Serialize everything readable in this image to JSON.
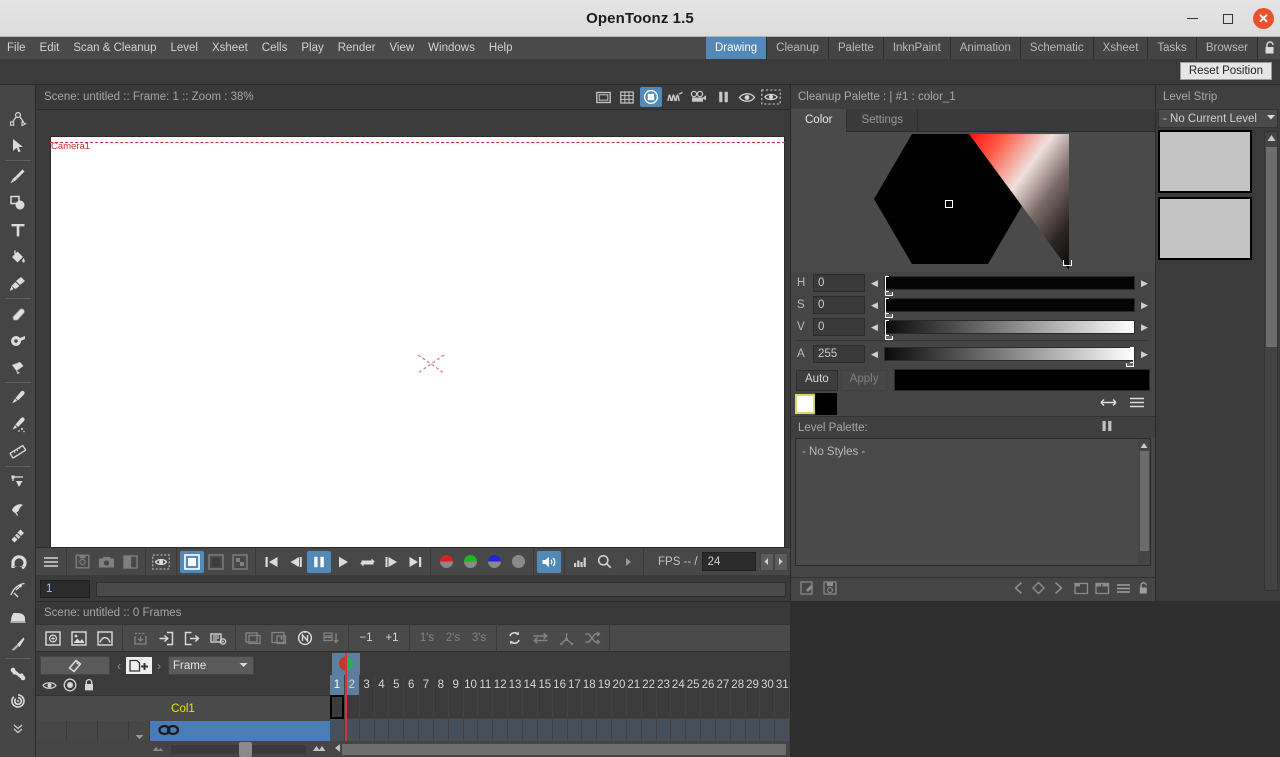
{
  "window": {
    "title": "OpenToonz 1.5",
    "minimize_icon": "minimize-icon",
    "maximize_icon": "maximize-icon",
    "close_icon": "close-icon"
  },
  "menubar": {
    "items": [
      {
        "label": "File"
      },
      {
        "label": "Edit"
      },
      {
        "label": "Scan & Cleanup"
      },
      {
        "label": "Level"
      },
      {
        "label": "Xsheet"
      },
      {
        "label": "Cells"
      },
      {
        "label": "Play"
      },
      {
        "label": "Render"
      },
      {
        "label": "View"
      },
      {
        "label": "Windows"
      },
      {
        "label": "Help"
      }
    ]
  },
  "rooms": {
    "tabs": [
      {
        "label": "Drawing",
        "active": true
      },
      {
        "label": "Cleanup",
        "active": false
      },
      {
        "label": "Palette",
        "active": false
      },
      {
        "label": "InknPaint",
        "active": false
      },
      {
        "label": "Animation",
        "active": false
      },
      {
        "label": "Schematic",
        "active": false
      },
      {
        "label": "Xsheet",
        "active": false
      },
      {
        "label": "Tasks",
        "active": false
      },
      {
        "label": "Browser",
        "active": false
      }
    ],
    "lock_icon": "unlocked-padlock-icon"
  },
  "toolbar_top": {
    "reset_position_label": "Reset Position"
  },
  "left_toolbar": {
    "tools": [
      {
        "name": "animate-tool",
        "icon": "animate-icon"
      },
      {
        "name": "selection-tool",
        "icon": "arrow-cursor-icon"
      },
      {
        "name": "brush-tool",
        "icon": "brush-icon"
      },
      {
        "name": "geometric-tool",
        "icon": "geometric-shapes-icon"
      },
      {
        "name": "type-tool",
        "icon": "text-t-icon"
      },
      {
        "name": "fill-tool",
        "icon": "paint-bucket-icon"
      },
      {
        "name": "smart-raster-brush-tool",
        "icon": "paint-brush-wide-icon"
      },
      {
        "name": "eraser-tool",
        "icon": "eraser-icon"
      },
      {
        "name": "tape-tool",
        "icon": "tape-icon"
      },
      {
        "name": "finger-tool",
        "icon": "finger-icon"
      },
      {
        "name": "style-picker-tool",
        "icon": "eyedropper-icon"
      },
      {
        "name": "rgb-picker-tool",
        "icon": "rgb-picker-icon"
      },
      {
        "name": "ruler-tool",
        "icon": "ruler-icon"
      },
      {
        "name": "control-point-editor-tool",
        "icon": "control-point-icon"
      },
      {
        "name": "pinch-tool",
        "icon": "pinch-icon"
      },
      {
        "name": "pump-tool",
        "icon": "pump-icon"
      },
      {
        "name": "magnet-tool",
        "icon": "magnet-icon"
      },
      {
        "name": "bender-tool",
        "icon": "bender-icon"
      },
      {
        "name": "iron-tool",
        "icon": "iron-icon"
      },
      {
        "name": "cutter-tool",
        "icon": "cutter-knife-icon"
      },
      {
        "name": "skeleton-tool",
        "icon": "bone-icon"
      },
      {
        "name": "tracker-tool",
        "icon": "spiral-tracker-icon"
      },
      {
        "name": "more-tools",
        "icon": "double-chevron-down-icon"
      }
    ]
  },
  "viewer": {
    "title": "Scene: untitled  ::  Frame: 1  ::  Zoom : 38%",
    "camera_label": "Camera1",
    "title_icons": [
      {
        "name": "safe-area-icon",
        "active": false
      },
      {
        "name": "field-guide-icon",
        "active": false
      },
      {
        "name": "camera-view-icon",
        "active": true
      },
      {
        "name": "3d-view-icon",
        "active": false
      },
      {
        "name": "camera-stand-view-icon",
        "active": false
      },
      {
        "name": "freeze-icon",
        "active": false
      },
      {
        "name": "preview-icon",
        "active": false
      },
      {
        "name": "subcamera-preview-icon",
        "active": false
      }
    ]
  },
  "playback": {
    "groups": [
      {
        "buttons": [
          {
            "name": "flipbook-menu",
            "icon": "hamburger-icon",
            "dim": false
          }
        ]
      },
      {
        "buttons": [
          {
            "name": "save-images-button",
            "icon": "save-image-icon",
            "dim": true
          },
          {
            "name": "snapshot-button",
            "icon": "camera-icon",
            "dim": true
          },
          {
            "name": "compare-button",
            "icon": "compare-icon",
            "dim": true
          }
        ]
      },
      {
        "buttons": [
          {
            "name": "histogram-toggle",
            "icon": "dotted-eye-icon",
            "dim": false
          }
        ]
      },
      {
        "buttons": [
          {
            "name": "white-bg-button",
            "icon": "white-bg-icon",
            "active": true
          },
          {
            "name": "black-bg-button",
            "icon": "black-bg-icon",
            "active": false
          },
          {
            "name": "checkered-bg-button",
            "icon": "checkered-bg-icon",
            "active": false
          }
        ]
      },
      {
        "buttons": [
          {
            "name": "first-frame-button",
            "icon": "skip-start-icon"
          },
          {
            "name": "previous-frame-button",
            "icon": "step-back-icon"
          },
          {
            "name": "pause-button",
            "icon": "pause-icon",
            "active": true
          },
          {
            "name": "play-button",
            "icon": "play-icon"
          },
          {
            "name": "loop-button",
            "icon": "loop-icon"
          },
          {
            "name": "next-frame-button",
            "icon": "step-forward-icon"
          },
          {
            "name": "last-frame-button",
            "icon": "skip-end-icon"
          }
        ]
      },
      {
        "buttons": [
          {
            "name": "red-channel-button",
            "icon": "red-channel-icon",
            "color": "#e02020"
          },
          {
            "name": "green-channel-button",
            "icon": "green-channel-icon",
            "color": "#21b521"
          },
          {
            "name": "blue-channel-button",
            "icon": "blue-channel-icon",
            "color": "#2323d8"
          },
          {
            "name": "matte-channel-button",
            "icon": "matte-channel-icon",
            "color": "#8a8a8a"
          }
        ]
      },
      {
        "buttons": [
          {
            "name": "sound-button",
            "icon": "speaker-icon",
            "active": true
          }
        ]
      },
      {
        "buttons": [
          {
            "name": "histogram-button",
            "icon": "bar-histogram-icon"
          },
          {
            "name": "zoom-button",
            "icon": "magnifier-icon"
          },
          {
            "name": "more-button",
            "icon": "triangle-right-icon"
          }
        ]
      }
    ],
    "fps_label": "FPS -- /",
    "fps_value": "24",
    "spin_left": "◀",
    "spin_right": "▶"
  },
  "frame_bar": {
    "current_frame": "1"
  },
  "cleanup_palette": {
    "title": "Cleanup Palette :  | #1 : color_1",
    "tabs": [
      {
        "label": "Color",
        "active": true
      },
      {
        "label": "Settings",
        "active": false
      }
    ],
    "sliders": [
      {
        "label": "H",
        "value": "0",
        "pos": 0,
        "type": "hue"
      },
      {
        "label": "S",
        "value": "0",
        "pos": 0,
        "type": "sat"
      },
      {
        "label": "V",
        "value": "0",
        "pos": 0,
        "type": "val"
      },
      {
        "label": "A",
        "value": "255",
        "pos": 100,
        "type": "alpha"
      }
    ],
    "auto_label": "Auto",
    "apply_label": "Apply",
    "preview_color": "#000000",
    "swatch_current": "#ffffff",
    "swatch_new": "#000000",
    "swatch_icons": [
      {
        "name": "swap-colors-icon"
      },
      {
        "name": "palette-options-menu-icon"
      }
    ],
    "bottom_icons": [
      {
        "name": "edit-palette-icon"
      },
      {
        "name": "save-palette-icon"
      },
      {
        "name": "previous-key-icon"
      },
      {
        "name": "set-key-icon"
      },
      {
        "name": "next-key-icon"
      },
      {
        "name": "new-style-page-icon"
      },
      {
        "name": "new-page-icon"
      },
      {
        "name": "options-menu-icon"
      },
      {
        "name": "lock-palette-icon"
      }
    ]
  },
  "level_palette": {
    "title": "Level Palette:",
    "freeze_icon": "pause-freeze-icon",
    "empty_text": "- No Styles -"
  },
  "level_strip": {
    "title": "Level Strip",
    "current_level": "- No Current Level",
    "dropdown_icon": "chevron-down-icon",
    "frames": [
      {
        "name": "level-strip-cell-1"
      },
      {
        "name": "level-strip-cell-2"
      }
    ]
  },
  "xsheet": {
    "title": "Scene: untitled  ::  0 Frames",
    "toolbar_groups": [
      {
        "buttons": [
          {
            "name": "new-vector-level-button",
            "icon": "new-vector-level-icon",
            "dim": false
          },
          {
            "name": "new-toonz-raster-level-button",
            "icon": "new-raster-level-icon",
            "dim": false
          },
          {
            "name": "new-raster-level-button",
            "icon": "new-raster-plain-icon",
            "dim": false
          }
        ]
      },
      {
        "buttons": [
          {
            "name": "save-all-levels-button",
            "icon": "save-all-icon",
            "dim": true
          },
          {
            "name": "load-level-button",
            "icon": "load-level-icon",
            "dim": false
          },
          {
            "name": "export-level-button",
            "icon": "export-level-icon",
            "dim": false
          },
          {
            "name": "scan-settings-button",
            "icon": "scan-settings-icon",
            "dim": false
          }
        ]
      },
      {
        "buttons": [
          {
            "name": "toggle-edit-in-place-button",
            "icon": "edit-in-place-icon",
            "dim": true
          },
          {
            "name": "sub-xsheet-button",
            "icon": "sub-xsheet-icon",
            "dim": true
          },
          {
            "name": "toggle-autorenumber-button",
            "icon": "circled-n-icon",
            "dim": false
          },
          {
            "name": "collapse-button",
            "icon": "collapse-rows-icon",
            "dim": true
          }
        ]
      },
      {
        "buttons": [
          {
            "name": "decrease-step-button",
            "label": "−1",
            "dim": false
          },
          {
            "name": "increase-step-button",
            "label": "+1",
            "dim": false
          }
        ]
      },
      {
        "buttons": [
          {
            "name": "step-1-button",
            "label": "1's",
            "dim": true
          },
          {
            "name": "step-2-button",
            "label": "2's",
            "dim": true
          },
          {
            "name": "step-3-button",
            "label": "3's",
            "dim": true
          }
        ]
      },
      {
        "buttons": [
          {
            "name": "repeat-button",
            "icon": "repeat-circular-icon",
            "dim": false
          },
          {
            "name": "each-button",
            "icon": "each-arrow-icon",
            "dim": true
          },
          {
            "name": "reframe-button",
            "icon": "reframe-icon",
            "dim": true
          },
          {
            "name": "random-button",
            "icon": "shuffle-icon",
            "dim": true
          }
        ]
      }
    ],
    "orientation_icon": "toggle-orientation-icon",
    "nav_prev_icon": "chevron-left-icon",
    "nav_next_icon": "chevron-right-icon",
    "new_level_icon": "new-level-plus-icon",
    "frame_display": "Frame",
    "frame_display_caret": "chevron-down-icon",
    "column_toggles": [
      {
        "name": "preview-visible-toggle",
        "icon": "eye-icon"
      },
      {
        "name": "camstand-visible-toggle",
        "icon": "camstand-icon"
      },
      {
        "name": "lock-column-toggle",
        "icon": "padlock-icon"
      }
    ],
    "column_name": "Col1",
    "column_thumb_icon": "chain-link-icon",
    "frame_numbers": [
      "1",
      "2",
      "3",
      "4",
      "5",
      "6",
      "7",
      "8",
      "9",
      "10",
      "11",
      "12",
      "13",
      "14",
      "15",
      "16",
      "17",
      "18",
      "19",
      "20",
      "21",
      "22",
      "23",
      "24",
      "25",
      "26",
      "27",
      "28",
      "29",
      "30",
      "31"
    ],
    "current_frame": "1",
    "onion_skin_icon": "onion-skin-marker-icon"
  },
  "colors": {
    "accent": "#5289b8",
    "panel_bg": "#454545",
    "dark_bg": "#3b3b3b",
    "titlebar_bg": "#e0e0e0",
    "column_label": "#e6e600",
    "close_button": "#e8532a"
  }
}
